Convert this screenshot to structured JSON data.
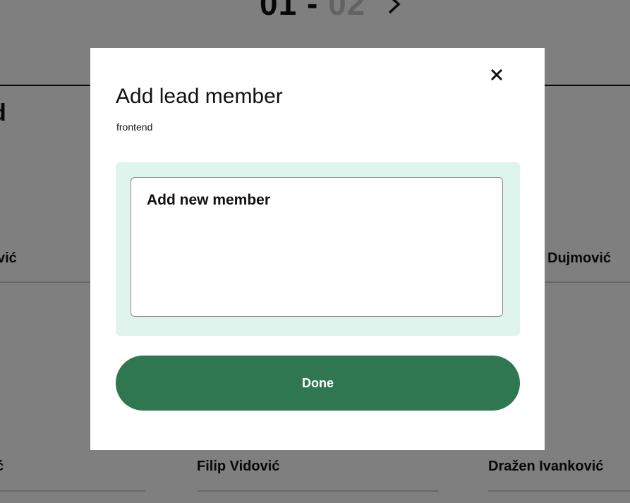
{
  "background": {
    "pager": {
      "current": "01",
      "separator": " - ",
      "total": "02",
      "next_icon": "chevron-right-icon"
    },
    "section_heading_fragment": "d",
    "people": [
      {
        "label": "vić"
      },
      {
        "label": "Dujmović"
      },
      {
        "label": "ć"
      },
      {
        "label": "Filip Vidović"
      },
      {
        "label": "Dražen Ivanković"
      }
    ]
  },
  "modal": {
    "title": "Add lead member",
    "subtitle": "frontend",
    "close_icon": "close-icon",
    "member_card_label": "Add new member",
    "done_label": "Done"
  },
  "colors": {
    "overlay": "rgba(0,0,0,0.5)",
    "panel_bg": "#e0f4ee",
    "done_button": "#2e7750"
  }
}
